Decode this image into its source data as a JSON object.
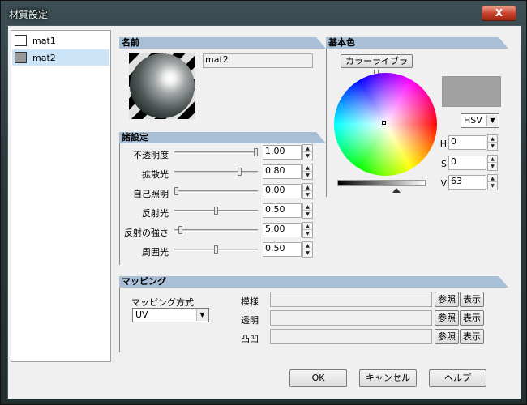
{
  "window": {
    "title": "材質設定",
    "close_label": "X"
  },
  "materials": [
    {
      "name": "mat1",
      "swatch": "#ffffff",
      "selected": false
    },
    {
      "name": "mat2",
      "swatch": "#999999",
      "selected": true
    }
  ],
  "name_section": {
    "header": "名前",
    "value": "mat2"
  },
  "props_section": {
    "header": "諸設定",
    "rows": [
      {
        "label": "不透明度",
        "value": "1.00",
        "level": 1.0
      },
      {
        "label": "拡散光",
        "value": "0.80",
        "level": 0.8
      },
      {
        "label": "自己照明",
        "value": "0.00",
        "level": 0.0
      },
      {
        "label": "反射光",
        "value": "0.50",
        "level": 0.5
      },
      {
        "label": "反射の強さ",
        "value": "5.00",
        "level": 0.05
      },
      {
        "label": "周囲光",
        "value": "0.50",
        "level": 0.5
      }
    ]
  },
  "color_section": {
    "header": "基本色",
    "library_button": "カラーライブラリ",
    "mode": "HSV",
    "swatch_color": "#a1a1a1",
    "h_label": "H",
    "h_value": "0",
    "s_label": "S",
    "s_value": "0",
    "v_label": "V",
    "v_value": "63"
  },
  "mapping_section": {
    "header": "マッピング",
    "method_label": "マッピング方式",
    "method_value": "UV",
    "rows": [
      {
        "label": "模様",
        "value": "",
        "browse": "参照",
        "show": "表示"
      },
      {
        "label": "透明",
        "value": "",
        "browse": "参照",
        "show": "表示"
      },
      {
        "label": "凸凹",
        "value": "",
        "browse": "参照",
        "show": "表示"
      }
    ]
  },
  "buttons": {
    "ok": "OK",
    "cancel": "キャンセル",
    "help": "ヘルプ"
  }
}
